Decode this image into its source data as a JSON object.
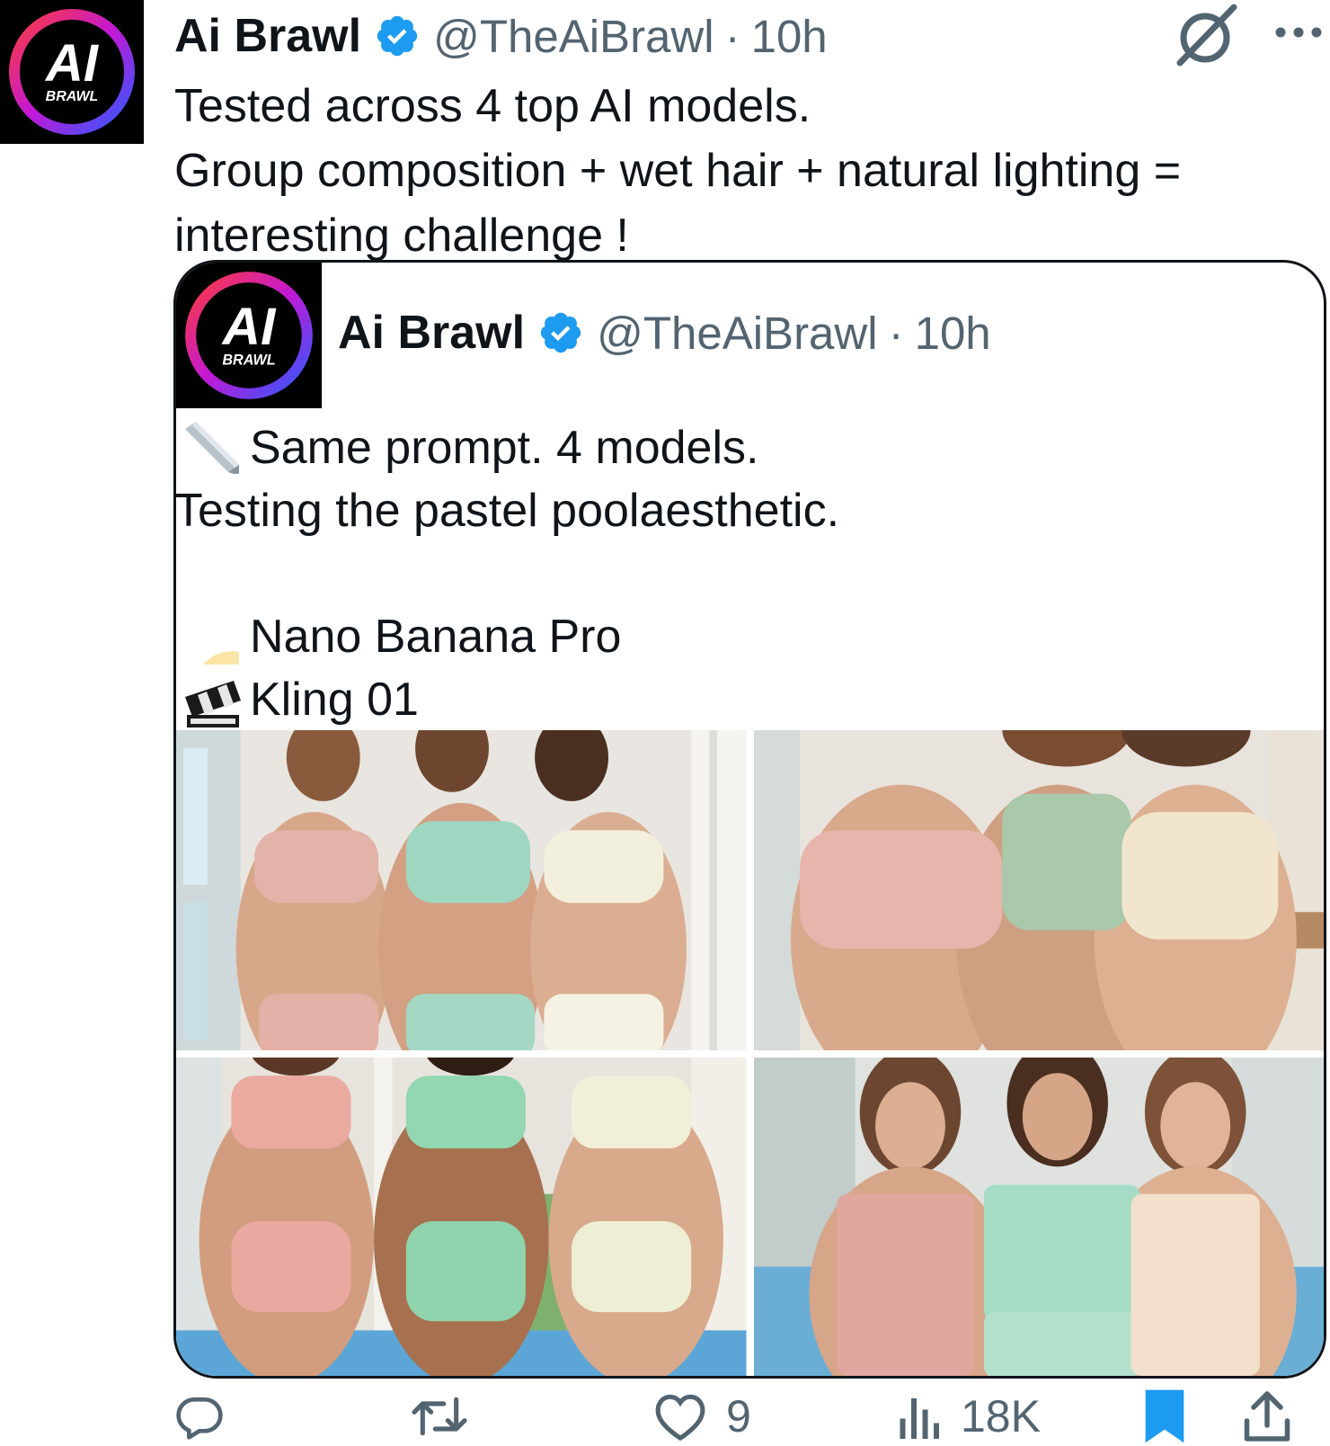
{
  "tweet": {
    "avatar_icon": "ai-brawl-logo",
    "display_name": "Ai Brawl",
    "handle": "@TheAiBrawl",
    "separator": "·",
    "time": "10h",
    "text": "Tested across 4 top AI models.\nGroup composition + wet hair + natural lighting = interesting challenge !"
  },
  "quoted": {
    "display_name": "Ai Brawl",
    "handle": "@TheAiBrawl",
    "separator": "·",
    "time": "10h",
    "lines": [
      {
        "emoji": "pencil-icon",
        "text": "Same prompt. 4 models."
      },
      {
        "emoji": "",
        "text": "Testing the pastel poolaesthetic."
      },
      {
        "emoji": "",
        "text": ""
      },
      {
        "emoji": "banana-icon",
        "text": "Nano Banana Pro"
      },
      {
        "emoji": "clapperboard-icon",
        "text": "Kling 01"
      }
    ],
    "media": [
      {
        "name": "image-1",
        "description": "three models in pink, mint and cream sets by a window"
      },
      {
        "name": "image-2",
        "description": "close group of three in pink, sage and cream tops"
      },
      {
        "name": "image-3",
        "description": "three models in pink, mint and cream sets by pool window"
      },
      {
        "name": "image-4",
        "description": "three models in pink, mint and beige camisoles by pool"
      }
    ]
  },
  "actions": {
    "reply": {
      "icon": "reply-icon",
      "count": ""
    },
    "retweet": {
      "icon": "retweet-icon",
      "count": ""
    },
    "like": {
      "icon": "heart-icon",
      "count": "9"
    },
    "views": {
      "icon": "views-icon",
      "count": "18K"
    },
    "bookmark": {
      "icon": "bookmark-icon",
      "active": true
    },
    "share": {
      "icon": "share-icon"
    }
  },
  "colors": {
    "verified": "#1d9bf0",
    "muted": "#536471",
    "text": "#0f1419",
    "bookmark": "#1d9bf0"
  }
}
